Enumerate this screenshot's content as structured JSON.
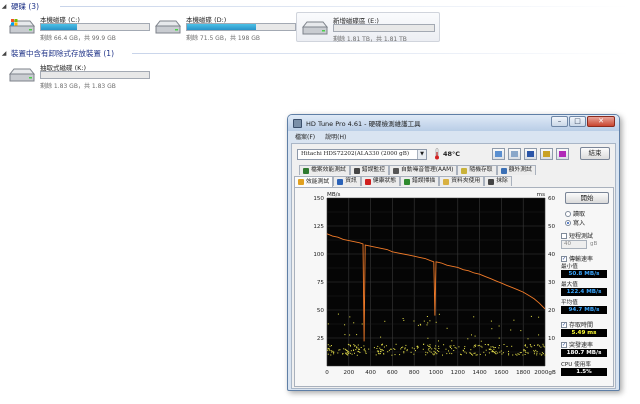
{
  "explorer": {
    "hard_disks_header": "硬碟 (3)",
    "removable_header": "裝置中含有卸除式存放裝置 (1)",
    "drives": [
      {
        "name": "本機磁碟 (C:)",
        "free": "剩餘 66.4 GB，共 99.9 GB",
        "used_fraction": 0.335
      },
      {
        "name": "本機磁碟 (D:)",
        "free": "剩餘 71.5 GB，共 198 GB",
        "used_fraction": 0.64
      },
      {
        "name": "新增磁碟區 (E:)",
        "free": "剩餘 1.81 TB，共 1.81 TB",
        "used_fraction": 0.0
      }
    ],
    "removable": [
      {
        "name": "抽取式磁碟 (K:)",
        "free": "剩餘 1.83 GB，共 1.83 GB",
        "used_fraction": 0.0
      }
    ]
  },
  "hdtune": {
    "title": "HD Tune Pro 4.61 - 硬碟檢測維護工具",
    "menu": [
      "檔案(F)",
      "說明(H)"
    ],
    "drive": "Hitachi HDS72202(ALA330 (2000 gB)",
    "temperature": "48°C",
    "exit_label": "結束",
    "tabs_row1": [
      {
        "label": "檔案效能測試",
        "icon": "file-icon",
        "color": "#2f7a2f"
      },
      {
        "label": "錯誤監控",
        "icon": "monitor-icon",
        "color": "#444"
      },
      {
        "label": "自動噪音管理(AAM)",
        "icon": "speaker-icon",
        "color": "#555"
      },
      {
        "label": "隨機存取",
        "icon": "random-icon",
        "color": "#c9b23a"
      },
      {
        "label": "額外測試",
        "icon": "extra-icon",
        "color": "#3a6fb5"
      }
    ],
    "tabs_row2": [
      {
        "label": "效能測試",
        "icon": "performance-icon",
        "color": "#e0a020"
      },
      {
        "label": "資訊",
        "icon": "info-icon",
        "color": "#2a62b8"
      },
      {
        "label": "健康狀態",
        "icon": "health-icon",
        "color": "#d02020"
      },
      {
        "label": "錯誤掃描",
        "icon": "scan-icon",
        "color": "#2e8a2e"
      },
      {
        "label": "資料夾使用",
        "icon": "folder-icon",
        "color": "#d8b040"
      },
      {
        "label": "抹除",
        "icon": "erase-icon",
        "color": "#444"
      }
    ],
    "side": {
      "start_label": "開始",
      "read_label": "讀取",
      "write_label": "寫入",
      "short_stroke_label": "短程測試",
      "short_stroke_value": "40",
      "short_stroke_unit": "gB",
      "transfer_rate_label": "傳輸速率",
      "min_label": "最小值",
      "min_value": "50.8 MB/s",
      "max_label": "最大值",
      "max_value": "122.4 MB/s",
      "avg_label": "平均值",
      "avg_value": "94.7 MB/s",
      "access_time_label": "存取時間",
      "access_time_value": "5.49 ms",
      "burst_rate_label": "突發速率",
      "burst_rate_value": "180.7 MB/s",
      "cpu_label": "CPU 使用率",
      "cpu_value": "1.5%"
    }
  },
  "chart_data": {
    "type": "line",
    "y_left_label": "MB/s",
    "y_right_label": "ms",
    "x_unit": "gB",
    "ylim_left": [
      0,
      150
    ],
    "ylim_right": [
      0,
      60
    ],
    "xlim": [
      0,
      2000
    ],
    "x_ticks": [
      0,
      200,
      400,
      600,
      800,
      1000,
      1200,
      1400,
      1600,
      1800,
      2000
    ],
    "y_left_ticks": [
      25,
      50,
      75,
      100,
      125,
      150
    ],
    "y_right_ticks": [
      10,
      20,
      30,
      40,
      50,
      60
    ],
    "series": [
      {
        "name": "傳輸速率",
        "color": "#f07a28",
        "x": [
          0,
          50,
          100,
          150,
          200,
          250,
          300,
          330,
          340,
          350,
          400,
          450,
          500,
          550,
          600,
          650,
          700,
          750,
          800,
          850,
          900,
          950,
          980,
          990,
          1000,
          1050,
          1100,
          1150,
          1200,
          1250,
          1300,
          1350,
          1400,
          1450,
          1500,
          1550,
          1600,
          1650,
          1700,
          1750,
          1800,
          1850,
          1900,
          1950,
          2000
        ],
        "y": [
          118,
          116,
          115,
          113,
          112,
          111,
          110,
          109,
          22,
          108,
          107,
          106,
          105,
          104,
          102,
          101,
          100,
          99,
          98,
          97,
          96,
          94,
          93,
          45,
          93,
          92,
          90,
          89,
          88,
          86,
          85,
          83,
          82,
          80,
          78,
          76,
          74,
          72,
          70,
          68,
          66,
          63,
          60,
          56,
          51
        ]
      }
    ]
  }
}
